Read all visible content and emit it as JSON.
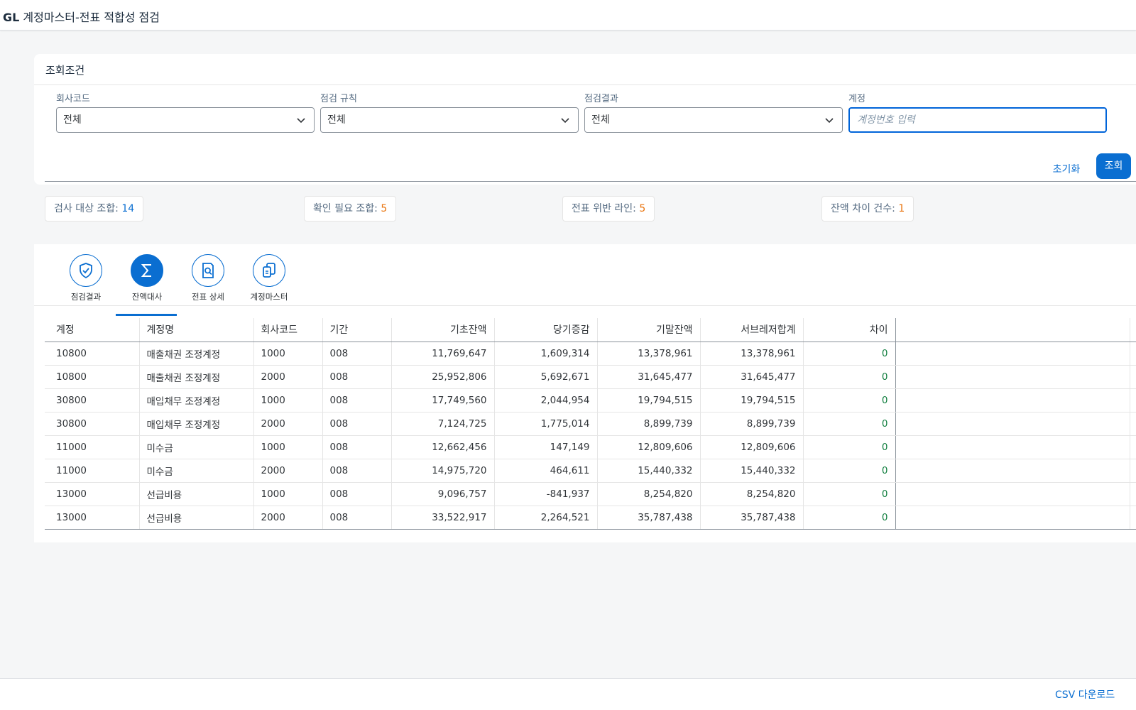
{
  "app": {
    "title_prefix": "GL",
    "title_rest": " 계정마스터-전표 적합성 점검"
  },
  "filter": {
    "header": "조회조건",
    "fields": [
      {
        "label": "회사코드",
        "value": "전체"
      },
      {
        "label": "점검 규칙",
        "value": "전체"
      },
      {
        "label": "점검결과",
        "value": "전체"
      }
    ],
    "account": {
      "label": "계정",
      "placeholder": "계정번호 입력"
    },
    "reset_label": "초기화",
    "search_label": "조회"
  },
  "summary": [
    {
      "label": "검사 대상 조합: ",
      "value": "14",
      "color": "#0a6ed1"
    },
    {
      "label": "확인 필요 조합: ",
      "value": "5",
      "color": "#e9730c"
    },
    {
      "label": "전표 위반 라인: ",
      "value": "5",
      "color": "#e9730c"
    },
    {
      "label": "잔액 차이 건수: ",
      "value": "1",
      "color": "#e9730c"
    }
  ],
  "tabs": [
    {
      "label": "점검결과",
      "icon": "shield-check-icon",
      "active": false
    },
    {
      "label": "잔액대사",
      "icon": "sigma-icon",
      "active": true
    },
    {
      "label": "전표 상세",
      "icon": "document-search-icon",
      "active": false
    },
    {
      "label": "계정마스터",
      "icon": "copy-documents-icon",
      "active": false
    }
  ],
  "table": {
    "columns": [
      "계정",
      "계정명",
      "회사코드",
      "기간",
      "기초잔액",
      "당기증감",
      "기말잔액",
      "서브레저합계",
      "차이"
    ],
    "rows": [
      [
        "10800",
        "매출채권 조정계정",
        "1000",
        "008",
        "11,769,647",
        "1,609,314",
        "13,378,961",
        "13,378,961",
        "0"
      ],
      [
        "10800",
        "매출채권 조정계정",
        "2000",
        "008",
        "25,952,806",
        "5,692,671",
        "31,645,477",
        "31,645,477",
        "0"
      ],
      [
        "30800",
        "매입채무 조정계정",
        "1000",
        "008",
        "17,749,560",
        "2,044,954",
        "19,794,515",
        "19,794,515",
        "0"
      ],
      [
        "30800",
        "매입채무 조정계정",
        "2000",
        "008",
        "7,124,725",
        "1,775,014",
        "8,899,739",
        "8,899,739",
        "0"
      ],
      [
        "11000",
        "미수금",
        "1000",
        "008",
        "12,662,456",
        "147,149",
        "12,809,606",
        "12,809,606",
        "0"
      ],
      [
        "11000",
        "미수금",
        "2000",
        "008",
        "14,975,720",
        "464,611",
        "15,440,332",
        "15,440,332",
        "0"
      ],
      [
        "13000",
        "선급비용",
        "1000",
        "008",
        "9,096,757",
        "-841,937",
        "8,254,820",
        "8,254,820",
        "0"
      ],
      [
        "13000",
        "선급비용",
        "2000",
        "008",
        "33,522,917",
        "2,264,521",
        "35,787,438",
        "35,787,438",
        "0"
      ]
    ]
  },
  "footer": {
    "csv_label": "CSV 다운로드"
  }
}
